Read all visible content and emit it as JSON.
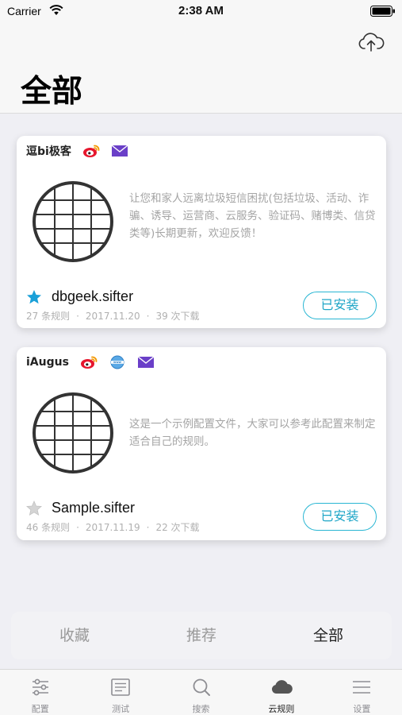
{
  "status_bar": {
    "carrier": "Carrier",
    "time": "2:38 AM"
  },
  "header": {
    "title": "全部"
  },
  "cards": [
    {
      "author": "逗bi极客",
      "icons": [
        "weibo-icon",
        "mail-icon"
      ],
      "description": "让您和家人远离垃圾短信困扰(包括垃圾、活动、诈骗、诱导、运营商、云服务、验证码、赌博类、信贷类等)长期更新，欢迎反馈！",
      "name": "dbgeek.sifter",
      "starred": true,
      "rules": "27 条规则",
      "date": "2017.11.20",
      "downloads": "39 次下载",
      "button": "已安装"
    },
    {
      "author": "iAugus",
      "icons": [
        "weibo-icon",
        "web-icon",
        "mail-icon"
      ],
      "description": "这是一个示例配置文件，大家可以参考此配置来制定适合自己的规则。",
      "name": "Sample.sifter",
      "starred": false,
      "rules": "46 条规则",
      "date": "2017.11.19",
      "downloads": "22 次下载",
      "button": "已安装"
    }
  ],
  "segments": [
    {
      "label": "收藏",
      "active": false
    },
    {
      "label": "推荐",
      "active": false
    },
    {
      "label": "全部",
      "active": true
    }
  ],
  "tabs": [
    {
      "label": "配置",
      "icon": "sliders-icon",
      "active": false
    },
    {
      "label": "测试",
      "icon": "document-icon",
      "active": false
    },
    {
      "label": "搜索",
      "icon": "search-icon",
      "active": false
    },
    {
      "label": "云规则",
      "icon": "cloud-icon",
      "active": true
    },
    {
      "label": "设置",
      "icon": "menu-icon",
      "active": false
    }
  ],
  "colors": {
    "accent": "#29b6d3",
    "star_active": "#1aa0d8",
    "star_inactive": "#c9c9c9",
    "mail": "#6a3fc8",
    "weibo": "#e6162d"
  }
}
